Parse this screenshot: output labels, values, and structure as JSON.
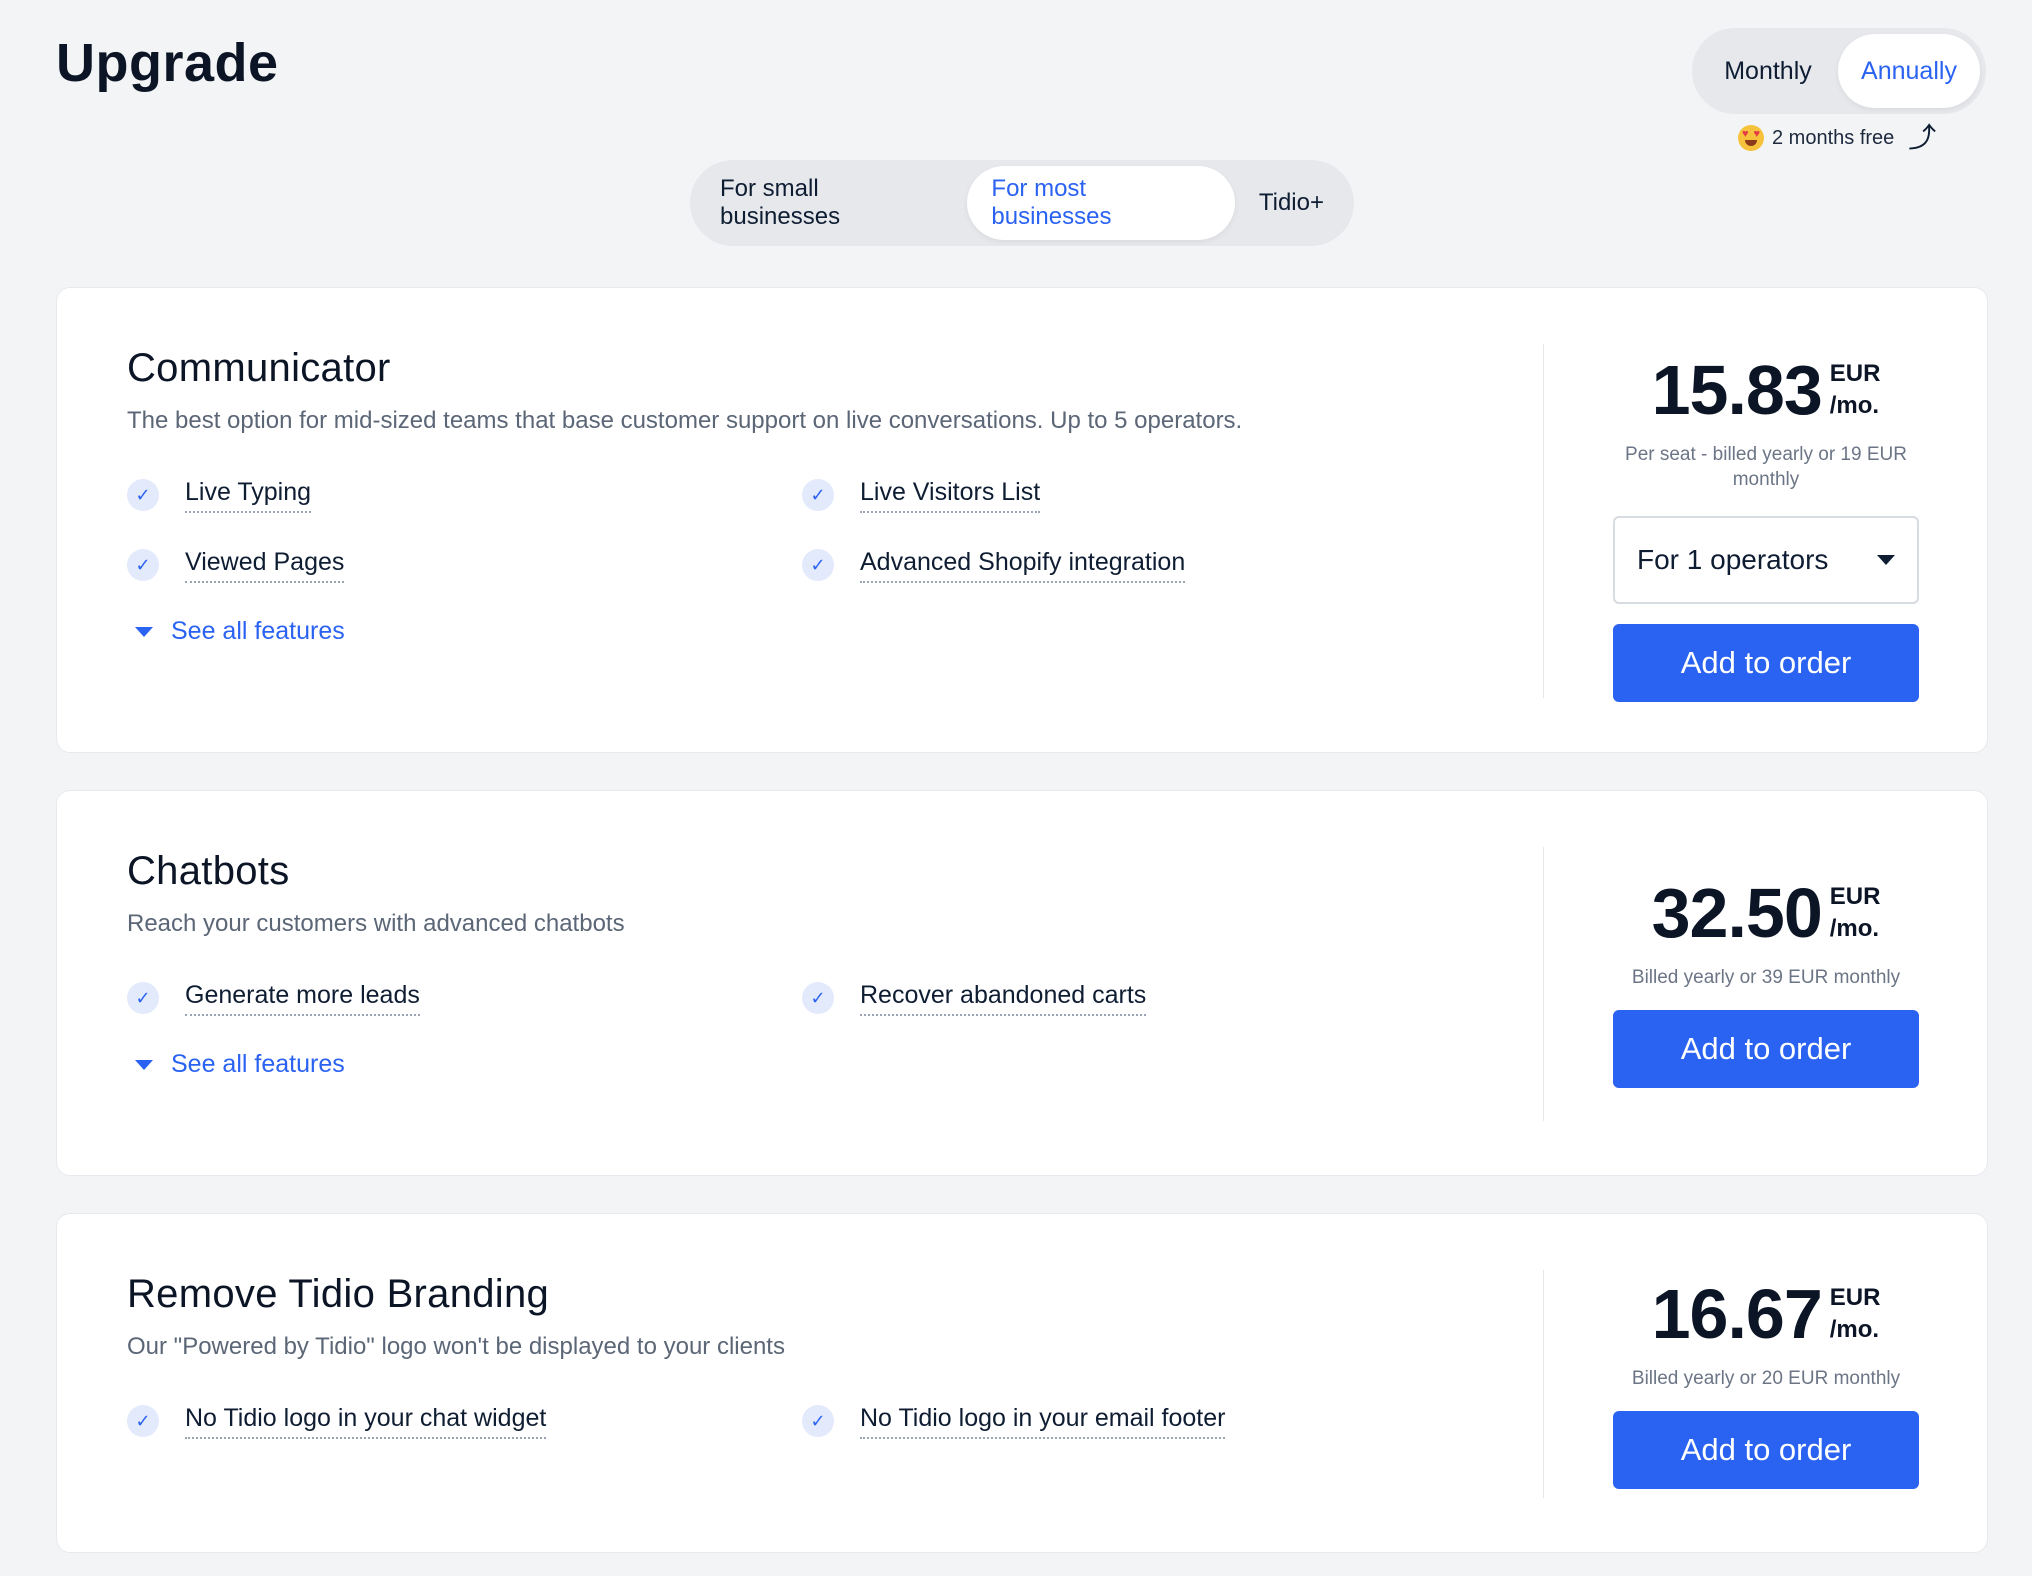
{
  "page": {
    "title": "Upgrade"
  },
  "billing": {
    "options": [
      "Monthly",
      "Annually"
    ],
    "selected": "Annually",
    "promo_text": "2 months free"
  },
  "segments": {
    "tabs": [
      "For small businesses",
      "For most businesses",
      "Tidio+"
    ],
    "selected": "For most businesses"
  },
  "cards": [
    {
      "title": "Communicator",
      "description": "The best option for mid-sized teams that base customer support on live conversations. Up to 5 operators.",
      "features": [
        "Live Typing",
        "Live Visitors List",
        "Viewed Pages",
        "Advanced Shopify integration"
      ],
      "see_all": "See all features",
      "price": "15.83",
      "currency": "EUR",
      "period": "/mo.",
      "note": "Per seat - billed yearly or 19 EUR monthly",
      "select_value": "For 1 operators",
      "button": "Add to order"
    },
    {
      "title": "Chatbots",
      "description": "Reach your customers with advanced chatbots",
      "features": [
        "Generate more leads",
        "Recover abandoned carts"
      ],
      "see_all": "See all features",
      "price": "32.50",
      "currency": "EUR",
      "period": "/mo.",
      "note": "Billed yearly or 39 EUR monthly",
      "button": "Add to order"
    },
    {
      "title": "Remove Tidio Branding",
      "description": "Our \"Powered by Tidio\" logo won't be displayed to your clients",
      "features": [
        "No Tidio logo in your chat widget",
        "No Tidio logo in your email footer"
      ],
      "price": "16.67",
      "currency": "EUR",
      "period": "/mo.",
      "note": "Billed yearly or 20 EUR monthly",
      "button": "Add to order"
    }
  ],
  "colors": {
    "accent": "#2a62f2",
    "background": "#f3f4f6",
    "card": "#ffffff"
  }
}
